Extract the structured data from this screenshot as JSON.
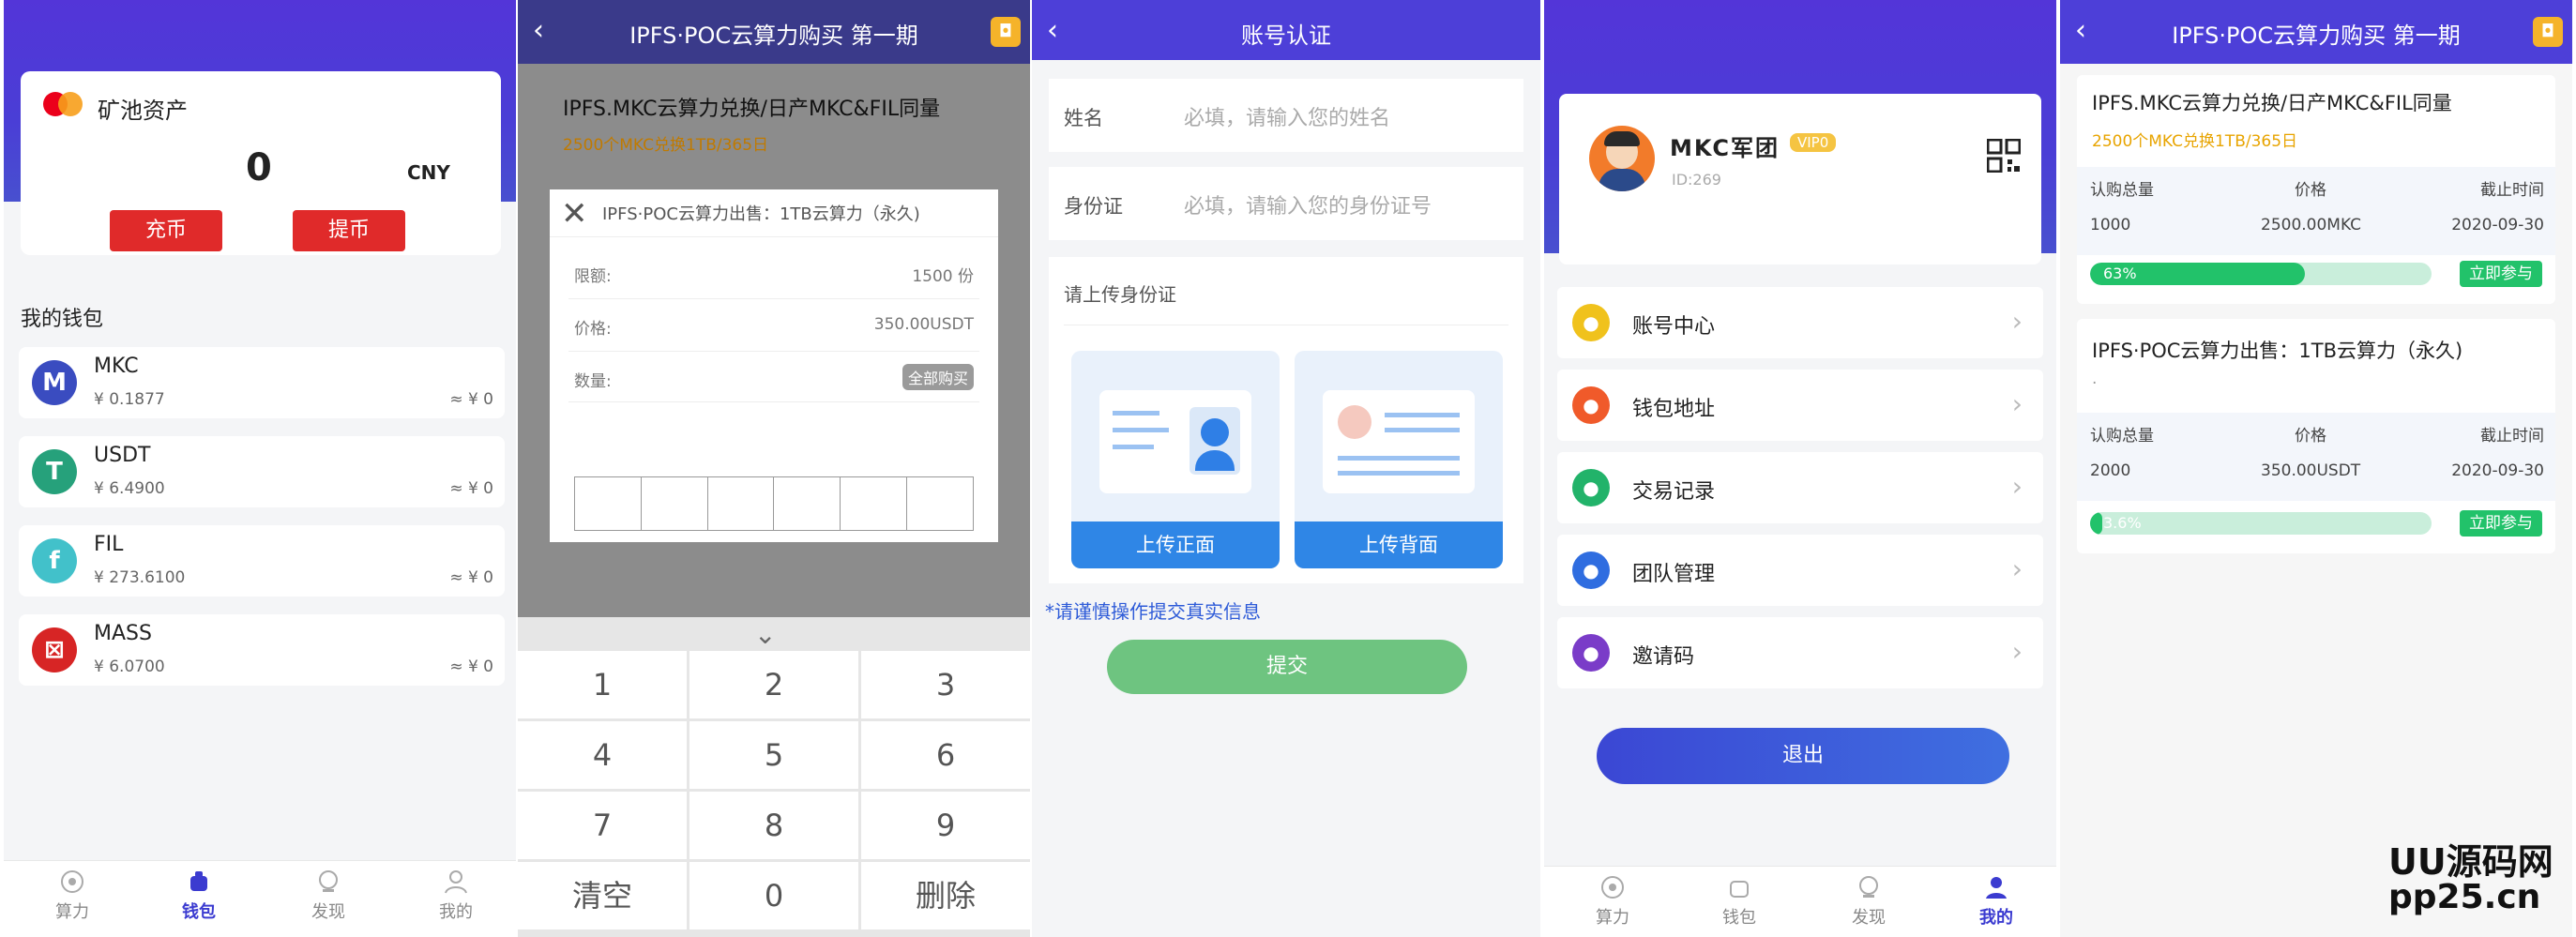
{
  "p1": {
    "card_title": "矿池资产",
    "balance": "0",
    "currency": "CNY",
    "recharge": "充币",
    "withdraw": "提币",
    "wallet_title": "我的钱包",
    "wallets": [
      {
        "name": "MKC",
        "price": "¥ 0.1877",
        "eq": "≈ ¥ 0",
        "color": "#3a4cc0",
        "icon": "mkc-icon"
      },
      {
        "name": "USDT",
        "price": "¥ 6.4900",
        "eq": "≈ ¥ 0",
        "color": "#26a17b",
        "icon": "usdt-icon"
      },
      {
        "name": "FIL",
        "price": "¥ 273.6100",
        "eq": "≈ ¥ 0",
        "color": "#42c1ca",
        "icon": "fil-icon"
      },
      {
        "name": "MASS",
        "price": "¥ 6.0700",
        "eq": "≈ ¥ 0",
        "color": "#d72525",
        "icon": "mass-icon"
      }
    ],
    "tabs": [
      "算力",
      "钱包",
      "发现",
      "我的"
    ]
  },
  "p2": {
    "title": "IPFS·POC云算力购买 第一期",
    "product_title": "IPFS.MKC云算力兑换/日产MKC&FIL同量",
    "product_sub": "2500个MKC兑换1TB/365日",
    "modal_title": "IPFS·POC云算力出售：1TB云算力（永久)",
    "limit_label": "限额:",
    "limit_value": "1500 份",
    "price_label": "价格:",
    "price_value": "350.00USDT",
    "qty_label": "数量:",
    "buy_all": "全部购买",
    "keys": [
      "1",
      "2",
      "3",
      "4",
      "5",
      "6",
      "7",
      "8",
      "9",
      "清空",
      "0",
      "删除"
    ]
  },
  "p3": {
    "title": "账号认证",
    "name_label": "姓名",
    "name_placeholder": "必填，请输入您的姓名",
    "id_label": "身份证",
    "id_placeholder": "必填，请输入您的身份证号",
    "upload_title": "请上传身份证",
    "front": "上传正面",
    "back": "上传背面",
    "notice": "*请谨慎操作提交真实信息",
    "submit": "提交"
  },
  "p4": {
    "username": "MKC军团",
    "vip": "VIP0",
    "uid": "ID:269",
    "menu": [
      {
        "label": "账号中心",
        "color": "#f0c21c",
        "icon": "account-icon"
      },
      {
        "label": "钱包地址",
        "color": "#f05a2a",
        "icon": "wallet-icon"
      },
      {
        "label": "交易记录",
        "color": "#22b36a",
        "icon": "record-icon"
      },
      {
        "label": "团队管理",
        "color": "#2f6de0",
        "icon": "team-icon"
      },
      {
        "label": "邀请码",
        "color": "#7a3cc8",
        "icon": "invite-icon"
      }
    ],
    "logout": "退出",
    "tabs": [
      "算力",
      "钱包",
      "发现",
      "我的"
    ]
  },
  "p5": {
    "title": "IPFS·POC云算力购买 第一期",
    "products": [
      {
        "title": "IPFS.MKC云算力兑换/日产MKC&FIL同量",
        "sub": "2500个MKC兑换1TB/365日",
        "h_total": "认购总量",
        "h_price": "价格",
        "h_deadline": "截止时间",
        "total": "1000",
        "price": "2500.00MKC",
        "deadline": "2020-09-30",
        "progress_label": "63%",
        "progress": 0.63,
        "join": "立即参与"
      },
      {
        "title": "IPFS·POC云算力出售：1TB云算力（永久)",
        "sub": ".",
        "h_total": "认购总量",
        "h_price": "价格",
        "h_deadline": "截止时间",
        "total": "2000",
        "price": "350.00USDT",
        "deadline": "2020-09-30",
        "progress_label": "3.6%",
        "progress": 0.036,
        "join": "立即参与"
      }
    ],
    "watermark_1": "UU源码网",
    "watermark_2": "pp25.cn"
  }
}
